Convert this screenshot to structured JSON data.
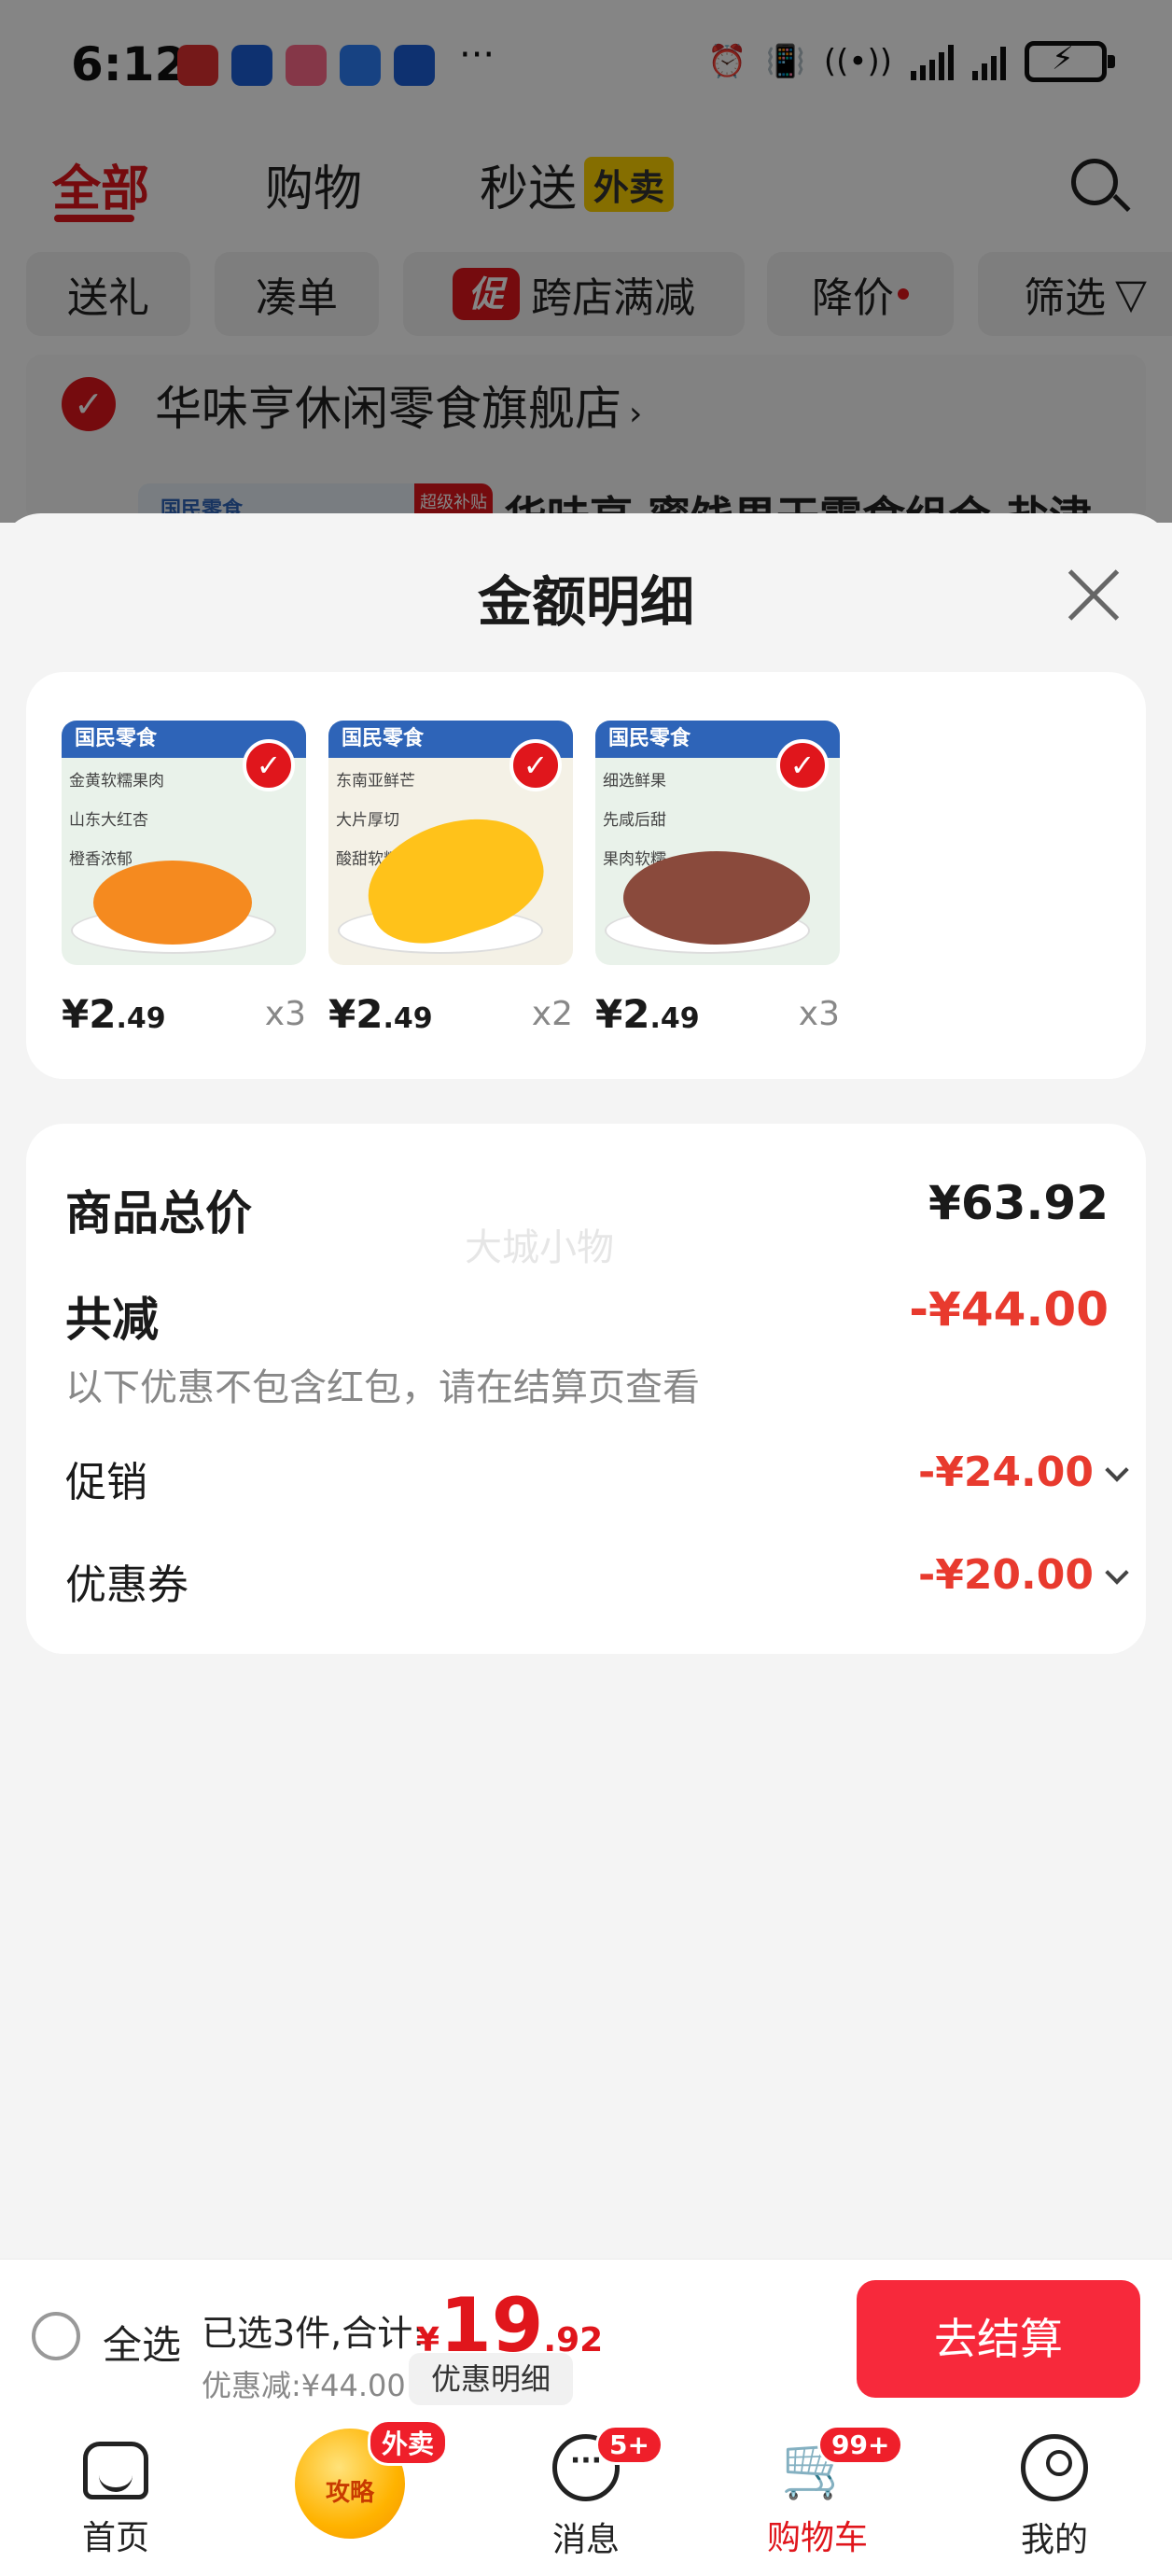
{
  "status_bar": {
    "time": "6:12",
    "app_icons": [
      "red-book-app-icon",
      "blue-c-app-icon",
      "618-app-icon",
      "blue-arrow-app-icon",
      "blue-c-app-icon-2"
    ],
    "more": "···"
  },
  "top_tabs": [
    {
      "label": "全部",
      "active": true
    },
    {
      "label": "购物",
      "active": false
    },
    {
      "label": "秒送",
      "active": false,
      "badge": "外卖"
    }
  ],
  "filter_chips": [
    {
      "label": "送礼"
    },
    {
      "label": "凑单"
    },
    {
      "label": "跨店满减",
      "badge": "促"
    },
    {
      "label": "降价"
    },
    {
      "label": "筛选"
    }
  ],
  "store": {
    "name": "华味亨休闲零食旗舰店",
    "chevron": "›",
    "product_title": "华味亨 蜜饯果干零食组合 盐津",
    "thumb_brand": "国民零食",
    "thumb_badge": "超级补贴日"
  },
  "sheet": {
    "title": "金额明细",
    "products": [
      {
        "brand": "国民零食",
        "tags": [
          "金黄软糯果肉",
          "山东大红杏",
          "橙香浓郁"
        ],
        "price_int": "¥2",
        "price_dec": ".49",
        "qty": "x3",
        "food_color": "#f58a1f"
      },
      {
        "brand": "国民零食",
        "tags": [
          "东南亚鲜芒",
          "大片厚切",
          "酸甜软糯"
        ],
        "price_int": "¥2",
        "price_dec": ".49",
        "qty": "x2",
        "food_color": "#ffc21a"
      },
      {
        "brand": "国民零食",
        "tags": [
          "细选鲜果",
          "先咸后甜",
          "果肉软糯"
        ],
        "price_int": "¥2",
        "price_dec": ".49",
        "qty": "x3",
        "food_color": "#8a4a3c"
      }
    ],
    "summary": {
      "total_label": "商品总价",
      "total_value": "¥63.92",
      "watermark": "大城小物",
      "reduce_label": "共减",
      "reduce_value": "-¥44.00",
      "note": "以下优惠不包含红包，请在结算页查看",
      "promo_label": "促销",
      "promo_value": "-¥24.00",
      "coupon_label": "优惠券",
      "coupon_value": "-¥20.00"
    }
  },
  "checkout": {
    "select_all": "全选",
    "selected_text": "已选3件,合计:",
    "currency": "¥",
    "total_int": "19",
    "total_dec": ".92",
    "discount_text": "优惠减:¥44.00",
    "detail_button": "优惠明细",
    "pay_button": "去结算"
  },
  "nav": {
    "items": [
      {
        "label": "首页",
        "icon": "home-icon"
      },
      {
        "label": "",
        "icon": "gift-icon",
        "badge": "外卖",
        "promo_text": "攻略"
      },
      {
        "label": "消息",
        "icon": "message-icon",
        "badge": "5+"
      },
      {
        "label": "购物车",
        "icon": "cart-icon",
        "badge": "99+",
        "active": true
      },
      {
        "label": "我的",
        "icon": "profile-icon"
      }
    ]
  },
  "colors": {
    "accent": "#e0161c",
    "price_red": "#e83a2e",
    "pay_button": "#f7293b"
  }
}
